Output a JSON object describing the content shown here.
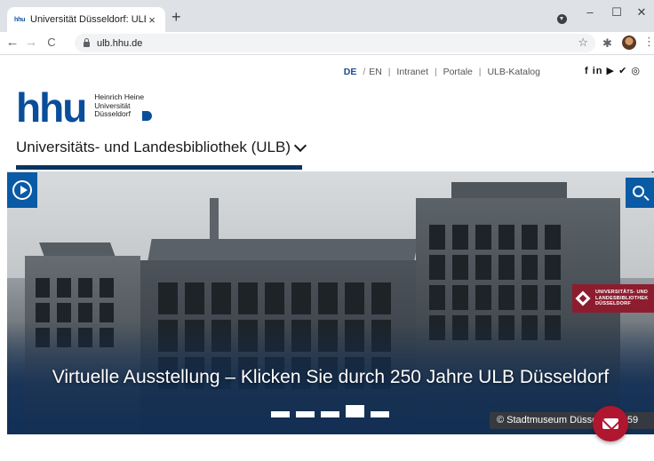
{
  "browser": {
    "tab": {
      "favicon": "hhu",
      "title": "Universität Düsseldorf: ULB",
      "close": "×"
    },
    "new_tab": "+",
    "window_controls": {
      "minimize": "–",
      "maximize": "☐",
      "close": "✕"
    },
    "nav": {
      "back": "←",
      "forward": "→",
      "reload": "C"
    },
    "url": "ulb.hhu.de",
    "star": "☆",
    "extensions": "✱",
    "menu": "⋮"
  },
  "topnav": {
    "lang_de": "DE",
    "lang_sep": "/",
    "lang_en": "EN",
    "links": [
      "Intranet",
      "Portale",
      "ULB-Katalog"
    ],
    "social": "f in ▶ ✔ ◎"
  },
  "logo": {
    "mark": "hhu",
    "line1": "Heinrich Heine",
    "line2": "Universität",
    "line3": "Düsseldorf"
  },
  "site_title": "Universitäts- und Landesbibliothek (ULB)",
  "hero": {
    "badge_line1": "UNIVERSITÄTS- UND",
    "badge_line2": "LANDESBIBLIOTHEK",
    "badge_line3": "DÜSSELDORF",
    "caption": "Virtuelle Ausstellung – Klicken Sie durch 250 Jahre ULB Düsseldorf",
    "slides": 5,
    "active_slide": 4,
    "credit": "© Stadtmuseum Düsseldorf, 259"
  },
  "colors": {
    "brand_blue": "#0a4e9b",
    "hero_button": "#0a5aa5",
    "badge": "#8c1d2e",
    "fab": "#b0162f"
  }
}
